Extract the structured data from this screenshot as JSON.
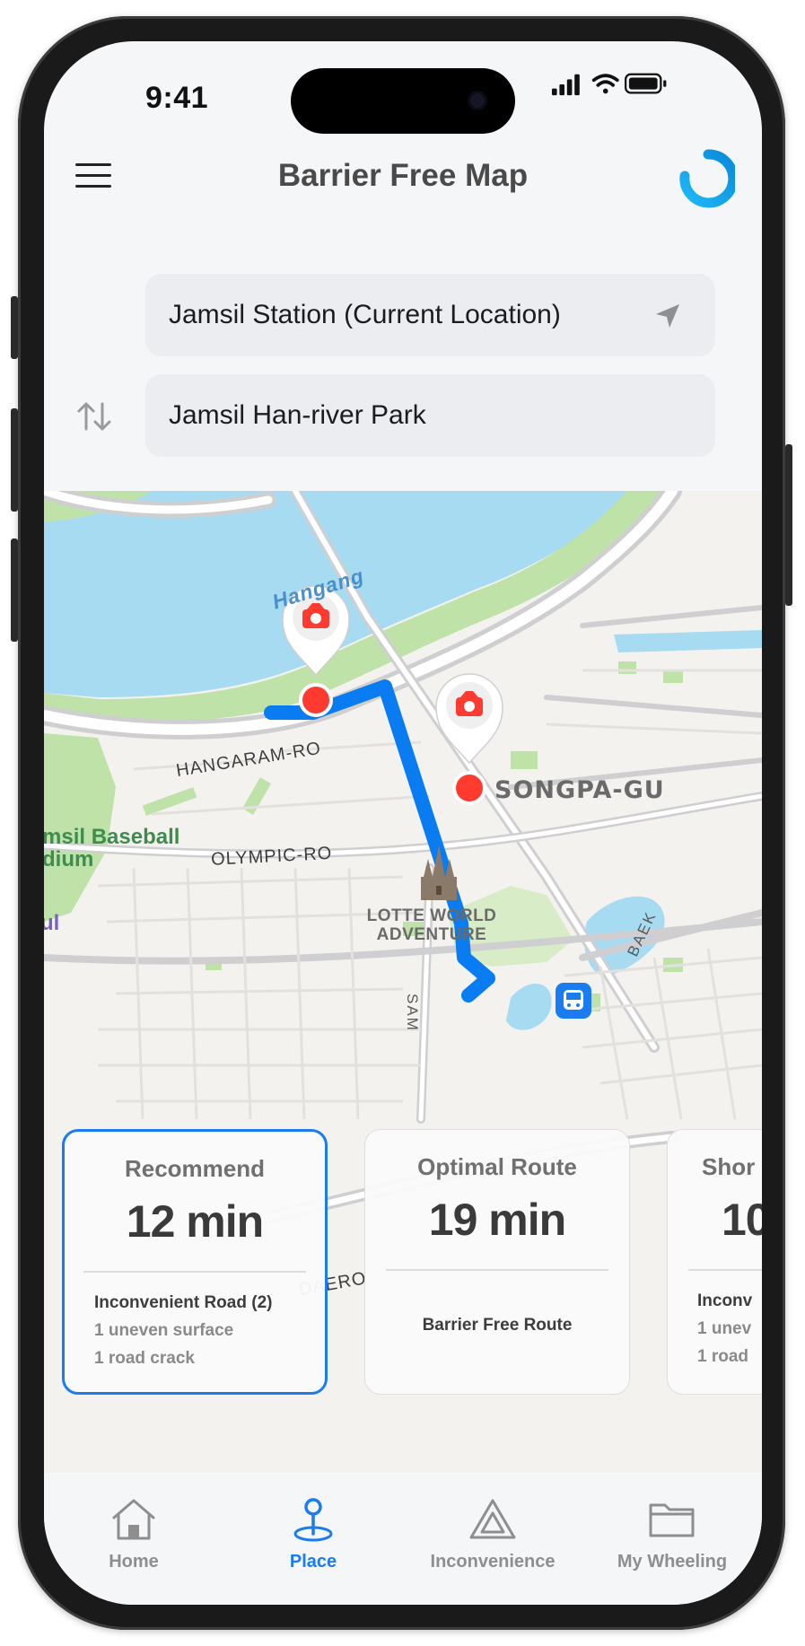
{
  "status_bar": {
    "time": "9:41"
  },
  "header": {
    "title": "Barrier Free Map"
  },
  "search": {
    "origin": "Jamsil Station (Current Location)",
    "destination": "Jamsil Han-river Park"
  },
  "map": {
    "labels": {
      "river": "Hangang",
      "road_hangaram": "HANGARAM-RO",
      "road_olympic": "OLYMPIC-RO",
      "district": "SONGPA-GU",
      "stadium_line1": "msil Baseball",
      "stadium_line2": "dium",
      "landmark_line1": "LOTTE WORLD",
      "landmark_line2": "ADVENTURE",
      "edge_left": "ul",
      "road_sam": "SAM",
      "road_baek": "BAEK",
      "road_daero": "DAERO"
    },
    "colors": {
      "route": "#0a7cf2",
      "marker": "#ff3b30",
      "water": "#a6dbf2",
      "park": "#bfe2a8"
    }
  },
  "routes": [
    {
      "label": "Recommend",
      "time": "12 min",
      "detail_title": "Inconvenient Road (2)",
      "detail_1": "1 uneven surface",
      "detail_2": "1 road crack"
    },
    {
      "label": "Optimal Route",
      "time": "19 min",
      "detail": "Barrier Free Route"
    },
    {
      "label": "Shor",
      "time": "10",
      "detail_title": "Inconv",
      "detail_1": "1 unev",
      "detail_2": "1 road"
    }
  ],
  "tabs": [
    {
      "label": "Home",
      "icon": "home-icon"
    },
    {
      "label": "Place",
      "icon": "pin-icon"
    },
    {
      "label": "Inconvenience",
      "icon": "warning-triangle-icon"
    },
    {
      "label": "My Wheeling",
      "icon": "folder-icon"
    }
  ]
}
